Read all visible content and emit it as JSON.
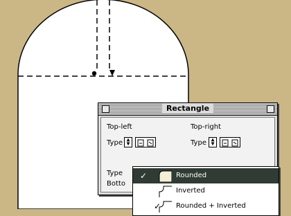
{
  "palette": {
    "title": "Rectangle",
    "top_left_label": "Top-left",
    "top_right_label": "Top-right",
    "type_label": "Type",
    "type_label_2": "Type",
    "type_label_3": "Type",
    "bottom_label_partial": "Botto"
  },
  "menu": {
    "items": [
      {
        "label": "Rounded",
        "checked": true,
        "check": "✓"
      },
      {
        "label": "Inverted",
        "checked": false,
        "check": ""
      },
      {
        "label": "Rounded + Inverted",
        "checked": false,
        "check": "✓"
      }
    ]
  },
  "colors": {
    "desktop": "#cbb786",
    "shape_fill": "#ffffff",
    "menu_highlight": "#2f3b34"
  },
  "icons": [
    "close-box-icon",
    "zoom-box-icon",
    "stepper-icon",
    "corner-type-icon",
    "checkmark-icon"
  ]
}
